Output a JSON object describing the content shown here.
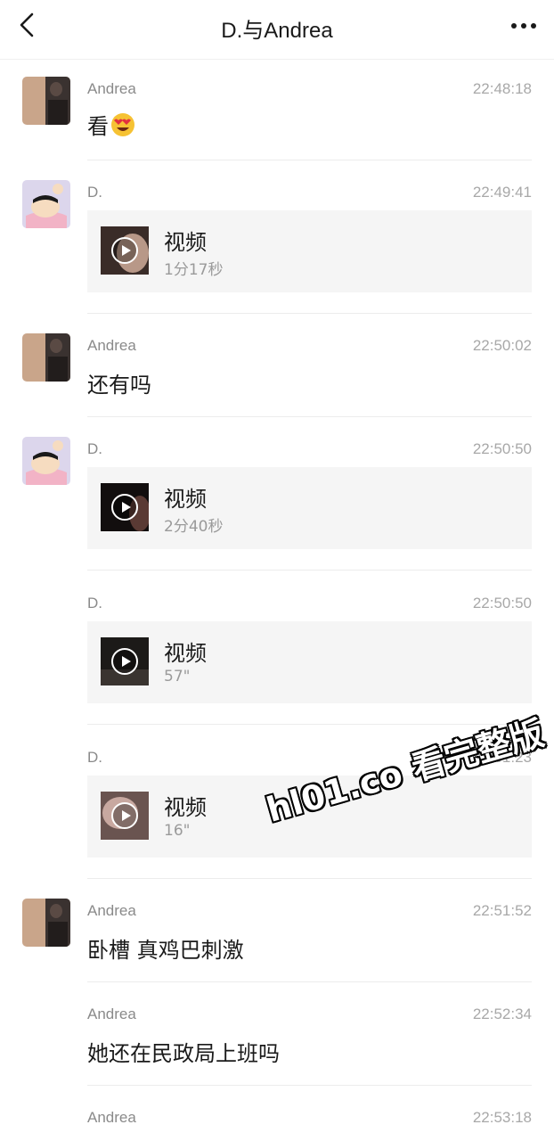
{
  "header": {
    "title": "D.与Andrea",
    "back_icon": "chevron-left-icon",
    "more_icon": "more-dots-icon"
  },
  "messages": [
    {
      "sender": "Andrea",
      "time": "22:48:18",
      "type": "text",
      "text": "看",
      "emoji": "heart-eyes-emoji"
    },
    {
      "sender": "D.",
      "time": "22:49:41",
      "type": "video",
      "title": "视频",
      "duration": "1分17秒"
    },
    {
      "sender": "Andrea",
      "time": "22:50:02",
      "type": "text",
      "text": "还有吗"
    },
    {
      "sender": "D.",
      "time": "22:50:50",
      "type": "video",
      "title": "视频",
      "duration": "2分40秒"
    },
    {
      "sender": "D.",
      "time": "22:50:50",
      "type": "video",
      "title": "视频",
      "duration": "57\""
    },
    {
      "sender": "D.",
      "time": "22:51:23",
      "type": "video",
      "title": "视频",
      "duration": "16\""
    },
    {
      "sender": "Andrea",
      "time": "22:51:52",
      "type": "text",
      "text": "卧槽 真鸡巴刺激"
    },
    {
      "sender": "Andrea",
      "time": "22:52:34",
      "type": "text",
      "text": "她还在民政局上班吗"
    },
    {
      "sender": "Andrea",
      "time": "22:53:18",
      "type": "text",
      "text": ""
    }
  ],
  "watermark": "hl01.co 看完整版",
  "colors": {
    "background": "#ffffff",
    "card": "#f5f5f5",
    "meta_text": "#a8a8a8"
  }
}
